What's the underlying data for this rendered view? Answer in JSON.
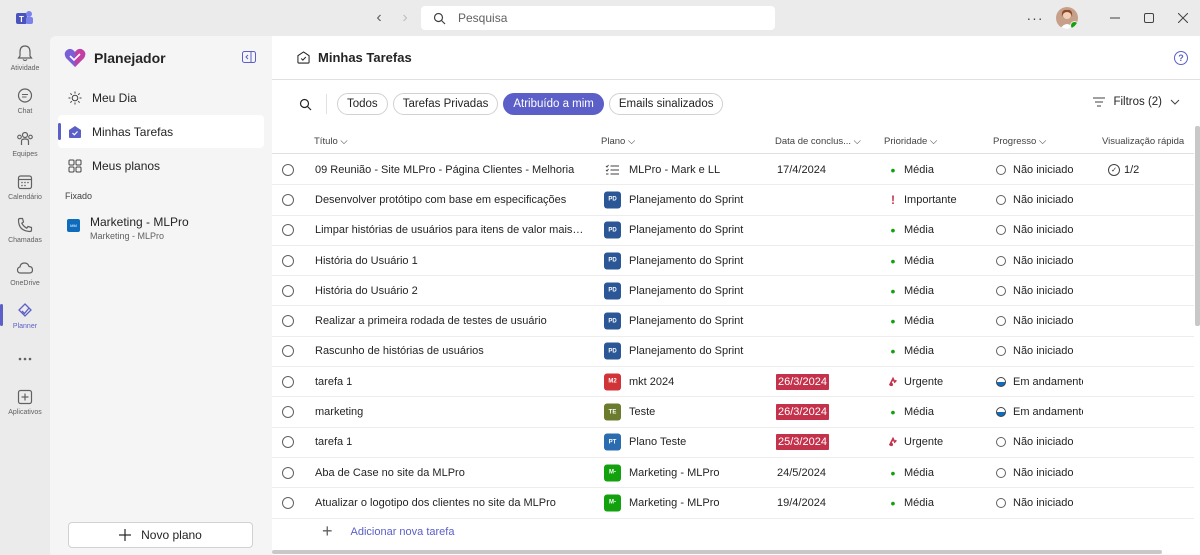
{
  "titlebar": {
    "search_placeholder": "Pesquisa",
    "more": "···"
  },
  "rail": {
    "items": [
      {
        "label": "Atividade",
        "icon": "bell-icon"
      },
      {
        "label": "Chat",
        "icon": "chat-icon"
      },
      {
        "label": "Equipes",
        "icon": "teams-icon"
      },
      {
        "label": "Calendário",
        "icon": "calendar-icon"
      },
      {
        "label": "Chamadas",
        "icon": "phone-icon"
      },
      {
        "label": "OneDrive",
        "icon": "cloud-icon"
      },
      {
        "label": "Planner",
        "icon": "planner-icon",
        "active": true
      },
      {
        "label": "",
        "icon": "more-icon"
      },
      {
        "label": "Aplicativos",
        "icon": "add-apps-icon"
      }
    ]
  },
  "sidebar": {
    "title": "Planejador",
    "items": [
      {
        "label": "Meu Dia"
      },
      {
        "label": "Minhas Tarefas",
        "active": true
      },
      {
        "label": "Meus planos"
      }
    ],
    "section_pinned": "Fixado",
    "pinned": {
      "badge": "MM",
      "title": "Marketing - MLPro",
      "subtitle": "Marketing - MLPro"
    },
    "new_plan": "Novo plano"
  },
  "main": {
    "title": "Minhas Tarefas",
    "help": "?",
    "filters": [
      "Todos",
      "Tarefas Privadas",
      "Atribuído a mim",
      "Emails sinalizados"
    ],
    "active_filter": "Atribuído a mim",
    "filters_label": "Filtros (2)",
    "columns": {
      "title": "Título",
      "plan": "Plano",
      "due": "Data de conclus...",
      "priority": "Prioridade",
      "progress": "Progresso",
      "quick_view": "Visualização rápida"
    },
    "add_task": "Adicionar nova tarefa"
  },
  "tasks": [
    {
      "title": "09 Reunião - Site MLPro - Página Clientes - Melhoria",
      "plan_badge": "",
      "plan_color": "",
      "plan": "MLPro - Mark e LL",
      "date": "17/4/2024",
      "late": false,
      "priority": "Média",
      "prio_kind": "medium",
      "progress": "Não iniciado",
      "prog_kind": "not",
      "qv": "1/2"
    },
    {
      "title": "Desenvolver protótipo com base em especificações",
      "plan_badge": "PD",
      "plan_color": "#2b5797",
      "plan": "Planejamento do Sprint",
      "date": "",
      "late": false,
      "priority": "Importante",
      "prio_kind": "important",
      "progress": "Não iniciado",
      "prog_kind": "not",
      "qv": ""
    },
    {
      "title": "Limpar histórias de usuários para itens de valor mais alto",
      "plan_badge": "PD",
      "plan_color": "#2b5797",
      "plan": "Planejamento do Sprint",
      "date": "",
      "late": false,
      "priority": "Média",
      "prio_kind": "medium",
      "progress": "Não iniciado",
      "prog_kind": "not",
      "qv": ""
    },
    {
      "title": "História do Usuário 1",
      "plan_badge": "PD",
      "plan_color": "#2b5797",
      "plan": "Planejamento do Sprint",
      "date": "",
      "late": false,
      "priority": "Média",
      "prio_kind": "medium",
      "progress": "Não iniciado",
      "prog_kind": "not",
      "qv": ""
    },
    {
      "title": "História do Usuário 2",
      "plan_badge": "PD",
      "plan_color": "#2b5797",
      "plan": "Planejamento do Sprint",
      "date": "",
      "late": false,
      "priority": "Média",
      "prio_kind": "medium",
      "progress": "Não iniciado",
      "prog_kind": "not",
      "qv": ""
    },
    {
      "title": "Realizar a primeira rodada de testes de usuário",
      "plan_badge": "PD",
      "plan_color": "#2b5797",
      "plan": "Planejamento do Sprint",
      "date": "",
      "late": false,
      "priority": "Média",
      "prio_kind": "medium",
      "progress": "Não iniciado",
      "prog_kind": "not",
      "qv": ""
    },
    {
      "title": "Rascunho de histórias de usuários",
      "plan_badge": "PD",
      "plan_color": "#2b5797",
      "plan": "Planejamento do Sprint",
      "date": "",
      "late": false,
      "priority": "Média",
      "prio_kind": "medium",
      "progress": "Não iniciado",
      "prog_kind": "not",
      "qv": ""
    },
    {
      "title": "tarefa 1",
      "plan_badge": "M2",
      "plan_color": "#d13438",
      "plan": "mkt 2024",
      "date": "26/3/2024",
      "late": true,
      "priority": "Urgente",
      "prio_kind": "urgent",
      "progress": "Em andamento",
      "prog_kind": "half",
      "qv": ""
    },
    {
      "title": "marketing",
      "plan_badge": "TE",
      "plan_color": "#6b7c2e",
      "plan": "Teste",
      "date": "26/3/2024",
      "late": true,
      "priority": "Média",
      "prio_kind": "medium",
      "progress": "Em andamento",
      "prog_kind": "half",
      "qv": ""
    },
    {
      "title": "tarefa 1",
      "plan_badge": "PT",
      "plan_color": "#2b6cb0",
      "plan": "Plano Teste",
      "date": "25/3/2024",
      "late": true,
      "priority": "Urgente",
      "prio_kind": "urgent",
      "progress": "Não iniciado",
      "prog_kind": "not",
      "qv": ""
    },
    {
      "title": "Aba de Case no site da MLPro",
      "plan_badge": "M-",
      "plan_color": "#13a10e",
      "plan": "Marketing - MLPro",
      "date": "24/5/2024",
      "late": false,
      "priority": "Média",
      "prio_kind": "medium",
      "progress": "Não iniciado",
      "prog_kind": "not",
      "qv": ""
    },
    {
      "title": "Atualizar o logotipo dos clientes no site da MLPro",
      "plan_badge": "M-",
      "plan_color": "#13a10e",
      "plan": "Marketing - MLPro",
      "date": "19/4/2024",
      "late": false,
      "priority": "Média",
      "prio_kind": "medium",
      "progress": "Não iniciado",
      "prog_kind": "not",
      "qv": ""
    }
  ]
}
